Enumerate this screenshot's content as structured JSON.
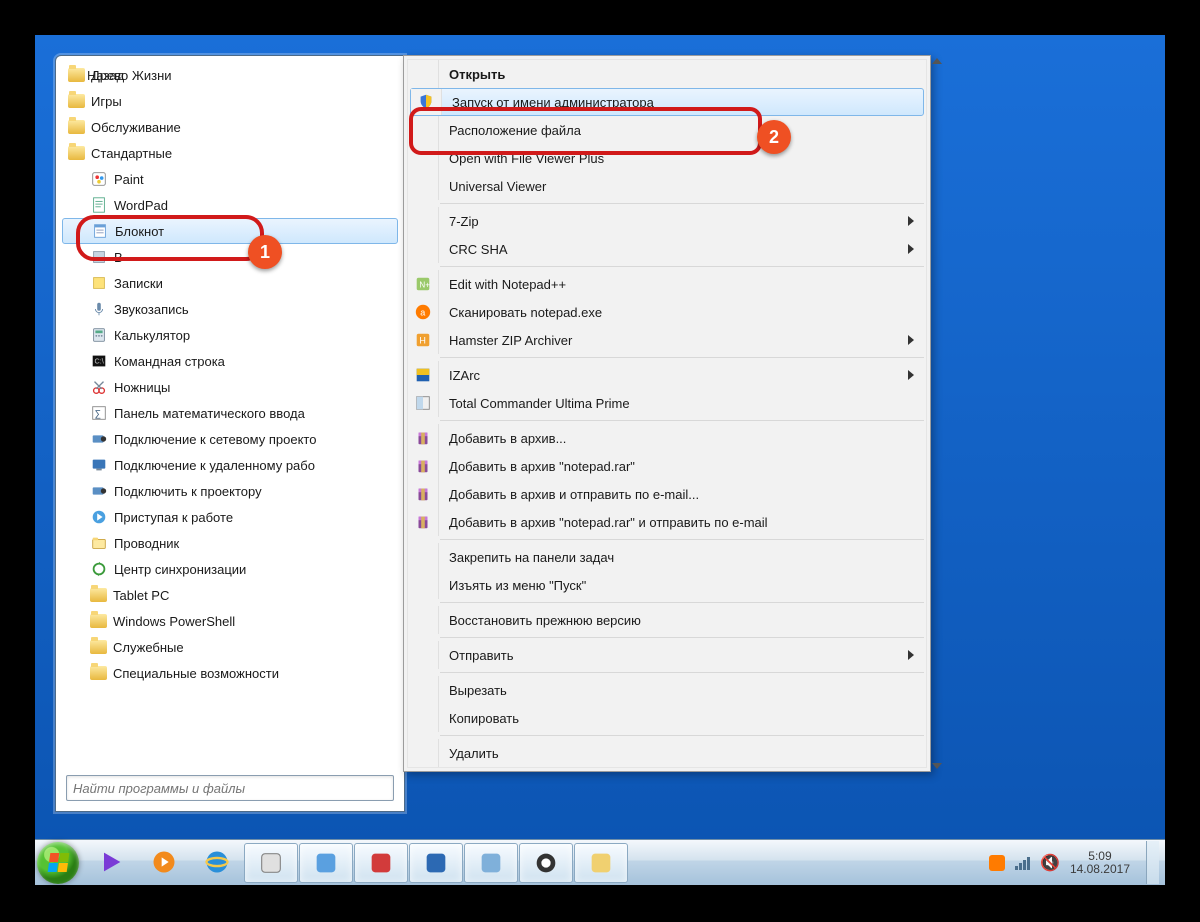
{
  "startMenu": {
    "folders_top": [
      {
        "label": "Древо Жизни"
      },
      {
        "label": "Игры"
      },
      {
        "label": "Обслуживание"
      },
      {
        "label": "Стандартные"
      }
    ],
    "apps": [
      {
        "label": "Paint",
        "icon": "paint"
      },
      {
        "label": "WordPad",
        "icon": "wordpad"
      },
      {
        "label": "Блокнот",
        "icon": "notepad",
        "selected": true
      },
      {
        "label": "В",
        "icon": "generic"
      },
      {
        "label": "Записки",
        "icon": "sticky"
      },
      {
        "label": "Звукозапись",
        "icon": "mic"
      },
      {
        "label": "Калькулятор",
        "icon": "calc"
      },
      {
        "label": "Командная строка",
        "icon": "cmd"
      },
      {
        "label": "Ножницы",
        "icon": "snip"
      },
      {
        "label": "Панель математического ввода",
        "icon": "math"
      },
      {
        "label": "Подключение к сетевому проекто",
        "icon": "netproj"
      },
      {
        "label": "Подключение к удаленному рабо",
        "icon": "rdp"
      },
      {
        "label": "Подключить к проектору",
        "icon": "proj"
      },
      {
        "label": "Приступая к работе",
        "icon": "start"
      },
      {
        "label": "Проводник",
        "icon": "explorer"
      },
      {
        "label": "Центр синхронизации",
        "icon": "sync"
      }
    ],
    "folders_bottom": [
      {
        "label": "Tablet PC"
      },
      {
        "label": "Windows PowerShell"
      },
      {
        "label": "Служебные"
      },
      {
        "label": "Специальные возможности"
      }
    ],
    "back_label": "Назад",
    "search_placeholder": "Найти программы и файлы"
  },
  "contextMenu": {
    "groups": [
      [
        {
          "label": "Открыть",
          "bold": true,
          "icon": null
        },
        {
          "label": "Запуск от имени администратора",
          "icon": "shield",
          "hover": true
        },
        {
          "label": "Расположение файла",
          "icon": null
        },
        {
          "label": "Open with File Viewer Plus",
          "icon": null
        },
        {
          "label": "Universal Viewer",
          "icon": null
        }
      ],
      [
        {
          "label": "7-Zip",
          "submenu": true
        },
        {
          "label": "CRC SHA",
          "submenu": true
        }
      ],
      [
        {
          "label": "Edit with Notepad++",
          "icon": "npp"
        },
        {
          "label": "Сканировать notepad.exe",
          "icon": "avast"
        },
        {
          "label": "Hamster ZIP Archiver",
          "icon": "hamster",
          "submenu": true
        }
      ],
      [
        {
          "label": "IZArc",
          "icon": "izarc",
          "submenu": true
        },
        {
          "label": "Total Commander Ultima Prime",
          "icon": "tc"
        }
      ],
      [
        {
          "label": "Добавить в архив...",
          "icon": "winrar"
        },
        {
          "label": "Добавить в архив \"notepad.rar\"",
          "icon": "winrar"
        },
        {
          "label": "Добавить в архив и отправить по e-mail...",
          "icon": "winrar"
        },
        {
          "label": "Добавить в архив \"notepad.rar\" и отправить по e-mail",
          "icon": "winrar"
        }
      ],
      [
        {
          "label": "Закрепить на панели задач"
        },
        {
          "label": "Изъять из меню \"Пуск\""
        }
      ],
      [
        {
          "label": "Восстановить прежнюю версию"
        }
      ],
      [
        {
          "label": "Отправить",
          "submenu": true
        }
      ],
      [
        {
          "label": "Вырезать"
        },
        {
          "label": "Копировать"
        }
      ],
      [
        {
          "label": "Удалить"
        }
      ]
    ]
  },
  "taskbar": {
    "clock_time": "5:09",
    "clock_date": "14.08.2017"
  },
  "annotations": {
    "badge1": "1",
    "badge2": "2"
  }
}
